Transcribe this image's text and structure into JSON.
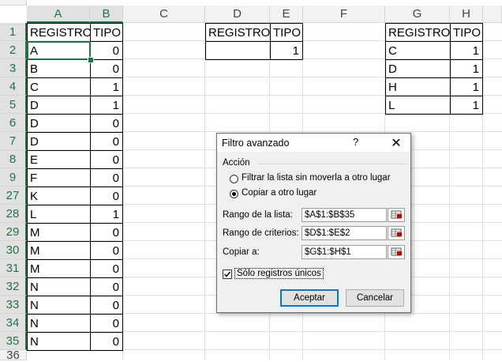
{
  "columns": [
    "A",
    "B",
    "C",
    "D",
    "E",
    "F",
    "G",
    "H"
  ],
  "rows": [
    "1",
    "2",
    "3",
    "4",
    "5",
    "6",
    "7",
    "8",
    "9",
    "27",
    "28",
    "29",
    "30",
    "31",
    "32",
    "33",
    "34",
    "35",
    "36"
  ],
  "colA": [
    "REGISTRO",
    "A",
    "B",
    "C",
    "D",
    "D",
    "D",
    "E",
    "F",
    "K",
    "L",
    "M",
    "M",
    "M",
    "N",
    "N",
    "N",
    "N"
  ],
  "colB": [
    "TIPO",
    "0",
    "0",
    "1",
    "1",
    "0",
    "0",
    "0",
    "0",
    "0",
    "1",
    "0",
    "0",
    "0",
    "0",
    "0",
    "0",
    "0"
  ],
  "criteria": {
    "h1": "REGISTRO",
    "h2": "TIPO",
    "v1": "",
    "v2": "1"
  },
  "output": {
    "h1": "REGISTRO",
    "h2": "TIPO",
    "rows": [
      [
        "C",
        "1"
      ],
      [
        "D",
        "1"
      ],
      [
        "H",
        "1"
      ],
      [
        "L",
        "1"
      ]
    ]
  },
  "dialog": {
    "title": "Filtro avanzado",
    "help": "?",
    "close": "✕",
    "group": "Acción",
    "opt1": "Filtrar la lista sin moverla a otro lugar",
    "opt2": "Copiar a otro lugar",
    "list_label": "Rango de la lista:",
    "list_value": "$A$1:$B$35",
    "crit_label": "Rango de criterios:",
    "crit_value": "$D$1:$E$2",
    "copy_label": "Copiar a:",
    "copy_value": "$G$1:$H$1",
    "unique_label": "Sólo registros únicos",
    "ok": "Aceptar",
    "cancel": "Cancelar"
  }
}
